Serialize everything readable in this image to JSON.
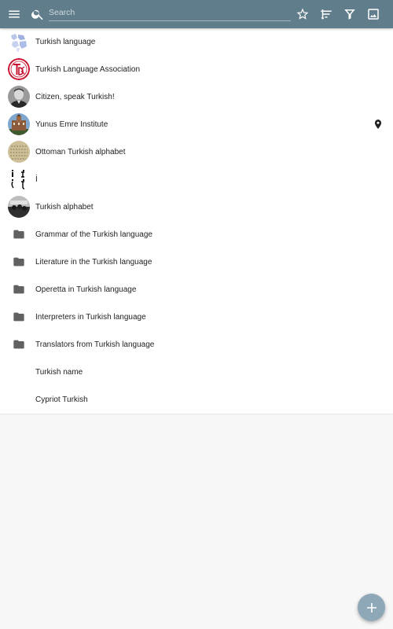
{
  "colors": {
    "toolbar": "#607d8b",
    "fab": "#8fa8b8",
    "folder_icon": "#616161",
    "text": "#222222"
  },
  "toolbar": {
    "menu_icon": "menu-icon",
    "search_icon": "search-icon",
    "search_placeholder": "Search",
    "search_value": "",
    "actions": [
      "star-icon",
      "sort-icon",
      "filter-icon",
      "image-icon"
    ]
  },
  "list": {
    "items": [
      {
        "label": "Turkish language",
        "icon": "turkish-language-map-thumbnail"
      },
      {
        "label": "Turkish Language Association",
        "icon": "tdk-logo-thumbnail"
      },
      {
        "label": "Citizen, speak Turkish!",
        "icon": "portrait-thumbnail"
      },
      {
        "label": "Yunus Emre Institute",
        "icon": "building-thumbnail",
        "trailing_icon": "location-pin-icon"
      },
      {
        "label": "Ottoman Turkish alphabet",
        "icon": "manuscript-thumbnail"
      },
      {
        "label": "İ",
        "icon": "letter-i-glyphs-thumbnail"
      },
      {
        "label": "Turkish alphabet",
        "icon": "historic-photo-thumbnail"
      },
      {
        "label": "Grammar of the Turkish language",
        "icon": "folder-icon"
      },
      {
        "label": "Literature in the Turkish language",
        "icon": "folder-icon"
      },
      {
        "label": "Operetta in Turkish language",
        "icon": "folder-icon"
      },
      {
        "label": "Interpreters in Turkish language",
        "icon": "folder-icon"
      },
      {
        "label": "Translators from Turkish language",
        "icon": "folder-icon"
      },
      {
        "label": "Turkish name",
        "icon": ""
      },
      {
        "label": "Cypriot Turkish",
        "icon": ""
      }
    ]
  },
  "fab": {
    "icon": "plus-icon"
  }
}
